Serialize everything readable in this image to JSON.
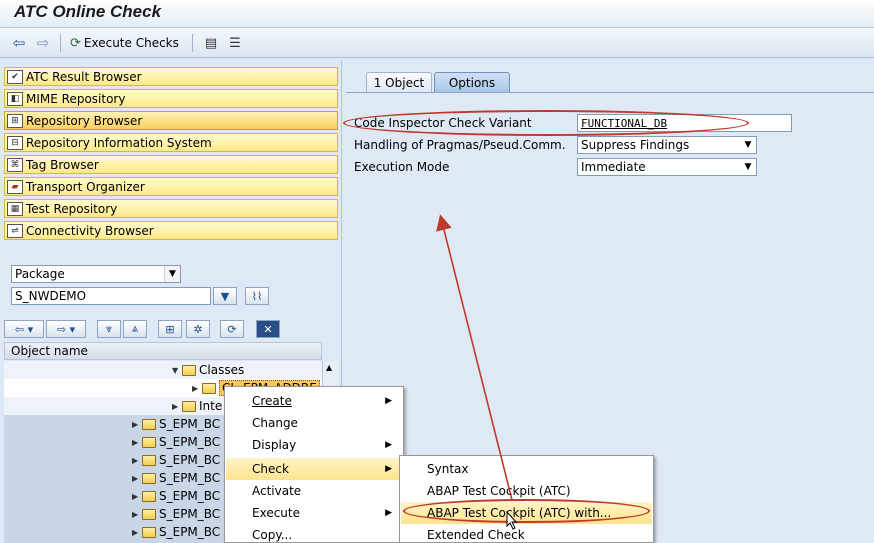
{
  "window": {
    "title": "ATC Online Check"
  },
  "toolbar": {
    "execute_checks": "Execute Checks"
  },
  "nav": {
    "items": [
      {
        "label": "ATC Result Browser",
        "active": false
      },
      {
        "label": "MIME Repository",
        "active": false
      },
      {
        "label": "Repository Browser",
        "active": true
      },
      {
        "label": "Repository Information System",
        "active": false
      },
      {
        "label": "Tag Browser",
        "active": false
      },
      {
        "label": "Transport Organizer",
        "active": false
      },
      {
        "label": "Test Repository",
        "active": false
      },
      {
        "label": "Connectivity Browser",
        "active": false
      }
    ]
  },
  "object_selector": {
    "type_value": "Package",
    "name_value": "S_NWDEMO"
  },
  "tree": {
    "header": "Object name",
    "rows": [
      {
        "label": "Classes",
        "level": 2
      },
      {
        "label": "CL_EPM_ADDRE",
        "level": 3
      },
      {
        "label": "Inte",
        "level": 2
      },
      {
        "label": "S_EPM_BC",
        "level": 0
      },
      {
        "label": "S_EPM_BC",
        "level": 0
      },
      {
        "label": "S_EPM_BC",
        "level": 0
      },
      {
        "label": "S_EPM_BC",
        "level": 0
      },
      {
        "label": "S_EPM_BC",
        "level": 0
      },
      {
        "label": "S_EPM_BC",
        "level": 0
      },
      {
        "label": "S_EPM_BC",
        "level": 0
      }
    ]
  },
  "tabs": [
    {
      "label": "1 Object"
    },
    {
      "label": "Options"
    }
  ],
  "form": {
    "variant_label": "Code Inspector Check Variant",
    "variant_value": "FUNCTIONAL_DB",
    "pragmas_label": "Handling of Pragmas/Pseud.Comm.",
    "pragmas_value": "Suppress Findings",
    "mode_label": "Execution Mode",
    "mode_value": "Immediate"
  },
  "context_menu": {
    "items": [
      {
        "label": "Create",
        "submenu": true
      },
      {
        "label": "Change",
        "submenu": false
      },
      {
        "label": "Display",
        "submenu": true
      },
      {
        "label": "Check",
        "submenu": true,
        "highlighted": true
      },
      {
        "label": "Activate",
        "submenu": false
      },
      {
        "label": "Execute",
        "submenu": true
      },
      {
        "label": "Copy...",
        "submenu": false
      }
    ]
  },
  "check_submenu": {
    "items": [
      {
        "label": "Syntax"
      },
      {
        "label": "ABAP Test Cockpit (ATC)"
      },
      {
        "label": "ABAP Test Cockpit (ATC) with...",
        "highlighted": true
      },
      {
        "label": "Extended Check"
      }
    ]
  },
  "colors": {
    "annotation": "#c0392b",
    "nav_button": "#fde98a",
    "menu_highlight": "#fde48e"
  }
}
